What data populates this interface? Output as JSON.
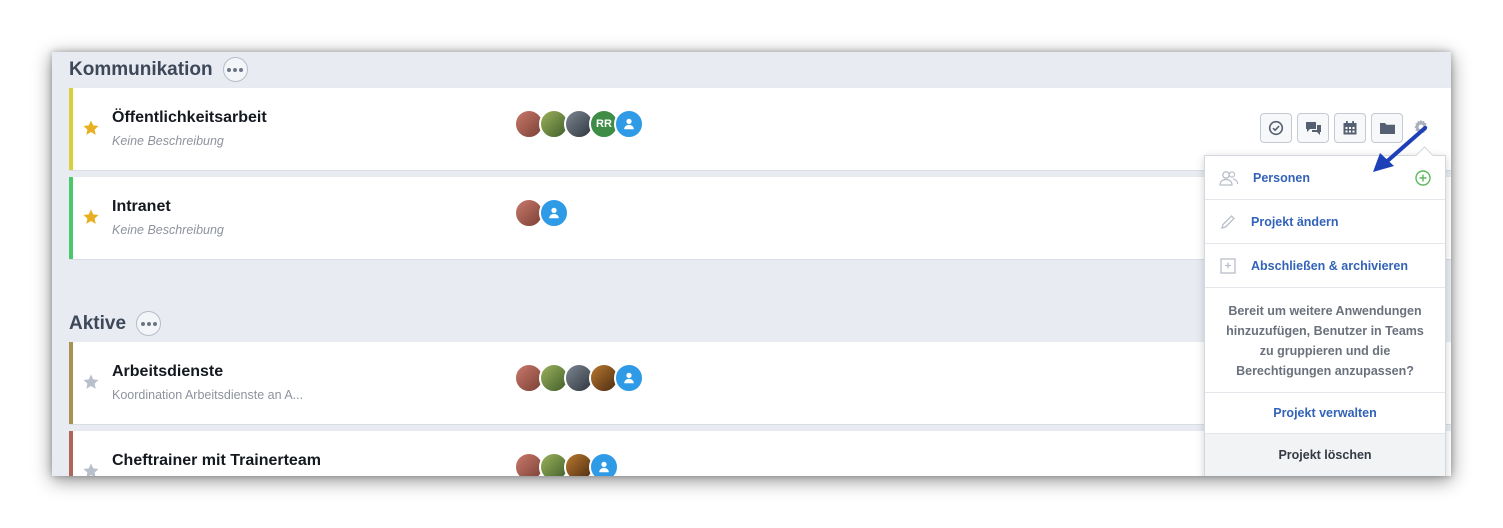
{
  "sections": [
    {
      "title": "Kommunikation"
    },
    {
      "title": "Aktive"
    }
  ],
  "projects": [
    {
      "title": "Öffentlichkeitsarbeit",
      "description": "Keine Beschreibung",
      "starred": true,
      "stripe_color": "#d8cf3a",
      "avatar_initials": "RR"
    },
    {
      "title": "Intranet",
      "description": "Keine Beschreibung",
      "starred": true,
      "stripe_color": "#4bc86a"
    },
    {
      "title": "Arbeitsdienste",
      "description": "Koordination Arbeitsdienste an A...",
      "starred": false,
      "stripe_color": "#a7924f"
    },
    {
      "title": "Cheftrainer mit Trainerteam",
      "description": "",
      "starred": false,
      "stripe_color": "#b0645c"
    }
  ],
  "toolbar": {
    "icons": [
      "tasks-icon",
      "chat-icon",
      "calendar-icon",
      "folder-icon",
      "gear-icon"
    ]
  },
  "menu": {
    "people_label": "Personen",
    "edit_label": "Projekt ändern",
    "archive_label": "Abschließen & archivieren",
    "info_text": "Bereit um weitere Anwendungen hinzuzufügen, Benutzer in Teams zu gruppieren und die Berechtigungen anzupassen?",
    "manage_label": "Projekt verwalten",
    "delete_label": "Projekt löschen"
  },
  "colors": {
    "accent_blue": "#3263b8",
    "star_gold": "#e8b020",
    "star_grey": "#b8c0cc",
    "avatar_generic": "#2f9be6",
    "avatar_initials_bg": "#3f8c47",
    "add_green": "#5cb85c",
    "arrow_blue": "#1d3fb8"
  }
}
